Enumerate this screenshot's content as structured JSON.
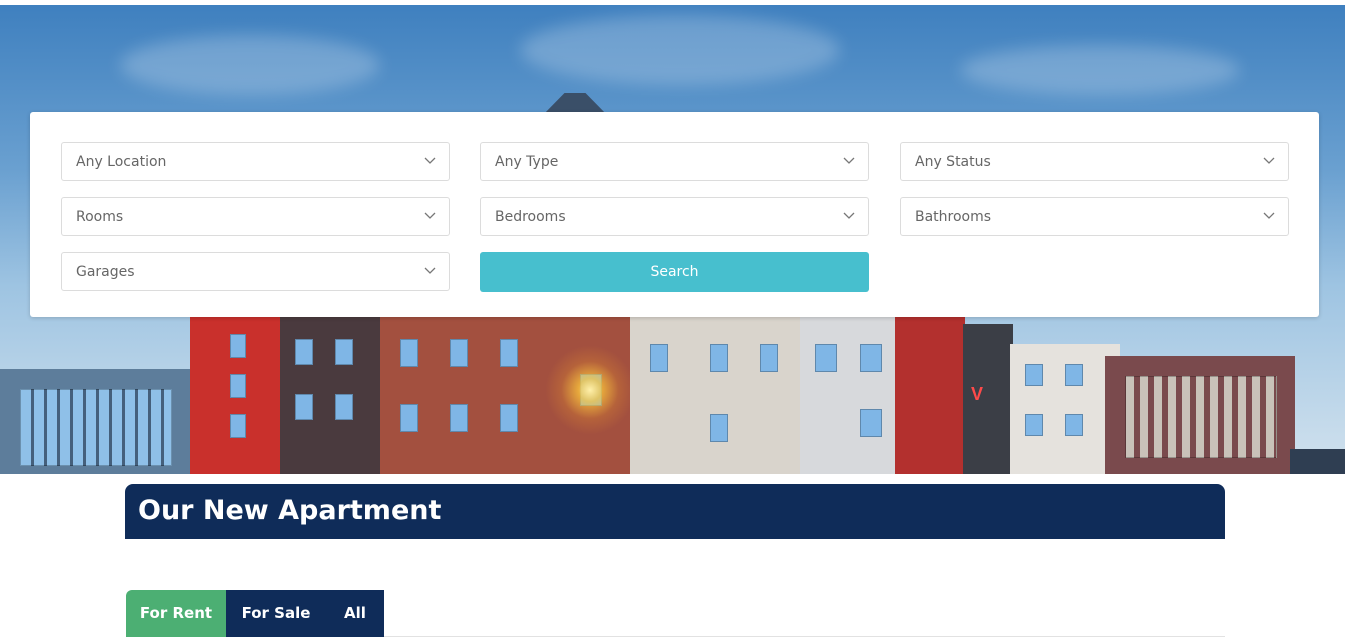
{
  "search": {
    "location": "Any Location",
    "type": "Any Type",
    "status": "Any Status",
    "rooms": "Rooms",
    "bedrooms": "Bedrooms",
    "bathrooms": "Bathrooms",
    "garages": "Garages",
    "search_label": "Search"
  },
  "section": {
    "title": "Our New Apartment"
  },
  "tabs": [
    {
      "label": "For Rent",
      "active": true
    },
    {
      "label": "For Sale",
      "active": false
    },
    {
      "label": "All",
      "active": false
    }
  ],
  "colors": {
    "accent": "#47bfce",
    "navy": "#0f2c59",
    "green": "#4caf73"
  },
  "icons": {
    "chevron": "chevron-down-icon"
  }
}
